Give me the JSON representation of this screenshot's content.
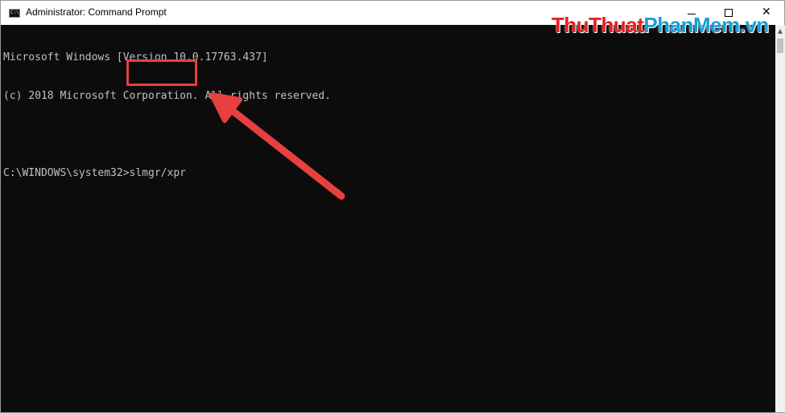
{
  "window": {
    "title": "Administrator: Command Prompt",
    "controls": {
      "minimize": "",
      "maximize": "",
      "close": "✕"
    }
  },
  "watermark": {
    "part1": "Thu",
    "part2": "Thuat",
    "part3": "Phan",
    "part4": "Mem",
    "part5": ".vn"
  },
  "console": {
    "lines": [
      "Microsoft Windows [Version 10.0.17763.437]",
      "(c) 2018 Microsoft Corporation. All rights reserved.",
      "",
      "C:\\WINDOWS\\system32>slmgr/xpr"
    ]
  },
  "scrollbar": {
    "up_arrow": "▲"
  },
  "colors": {
    "console_bg": "#0c0c0c",
    "console_text": "#c0c0c0",
    "highlight": "#e8403f",
    "watermark_red": "#e8201e",
    "watermark_blue": "#1aa0d8"
  },
  "icons": {
    "app": "cmd-icon",
    "minimize": "minimize-icon",
    "maximize": "maximize-icon",
    "close": "close-icon",
    "annotation": "arrow-icon"
  }
}
